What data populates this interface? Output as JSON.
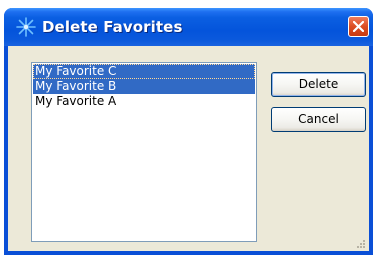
{
  "window": {
    "title": "Delete Favorites",
    "icon": "sparkle-icon",
    "close_icon": "close-icon"
  },
  "favorites": {
    "items": [
      {
        "label": "My Favorite C",
        "selected": true,
        "focused": true
      },
      {
        "label": "My Favorite B",
        "selected": true,
        "focused": false
      },
      {
        "label": "My Favorite A",
        "selected": false,
        "focused": false
      }
    ]
  },
  "buttons": {
    "delete_label": "Delete",
    "cancel_label": "Cancel"
  },
  "colors": {
    "titlebar": "#0454db",
    "selection": "#316ac5",
    "dialog_face": "#ece9d8",
    "close_button": "#dc4d22"
  }
}
